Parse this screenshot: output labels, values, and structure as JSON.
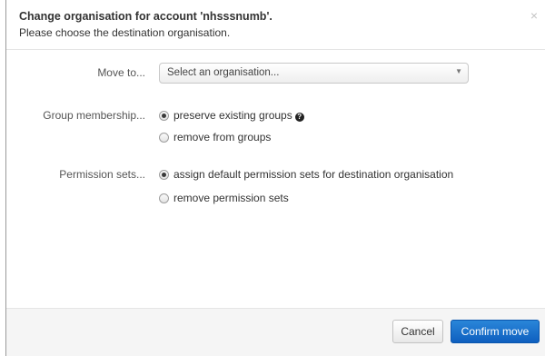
{
  "dialog": {
    "title": "Change organisation for account 'nhsssnumb'.",
    "subtitle": "Please choose the destination organisation.",
    "close_glyph": "×"
  },
  "move_to": {
    "label": "Move to...",
    "select_value": "Select an organisation...",
    "arrow_glyph": "▼"
  },
  "group_membership": {
    "label": "Group membership...",
    "options": [
      {
        "label": "preserve existing groups",
        "checked": true
      },
      {
        "label": "remove from groups",
        "checked": false
      }
    ],
    "help_glyph": "?"
  },
  "permission_sets": {
    "label": "Permission sets...",
    "options": [
      {
        "label": "assign default permission sets for destination organisation",
        "checked": true
      },
      {
        "label": "remove permission sets",
        "checked": false
      }
    ]
  },
  "footer": {
    "cancel_label": "Cancel",
    "confirm_label": "Confirm move"
  },
  "colors": {
    "primary": "#1b73cf",
    "footer_bg": "#f5f5f5"
  }
}
